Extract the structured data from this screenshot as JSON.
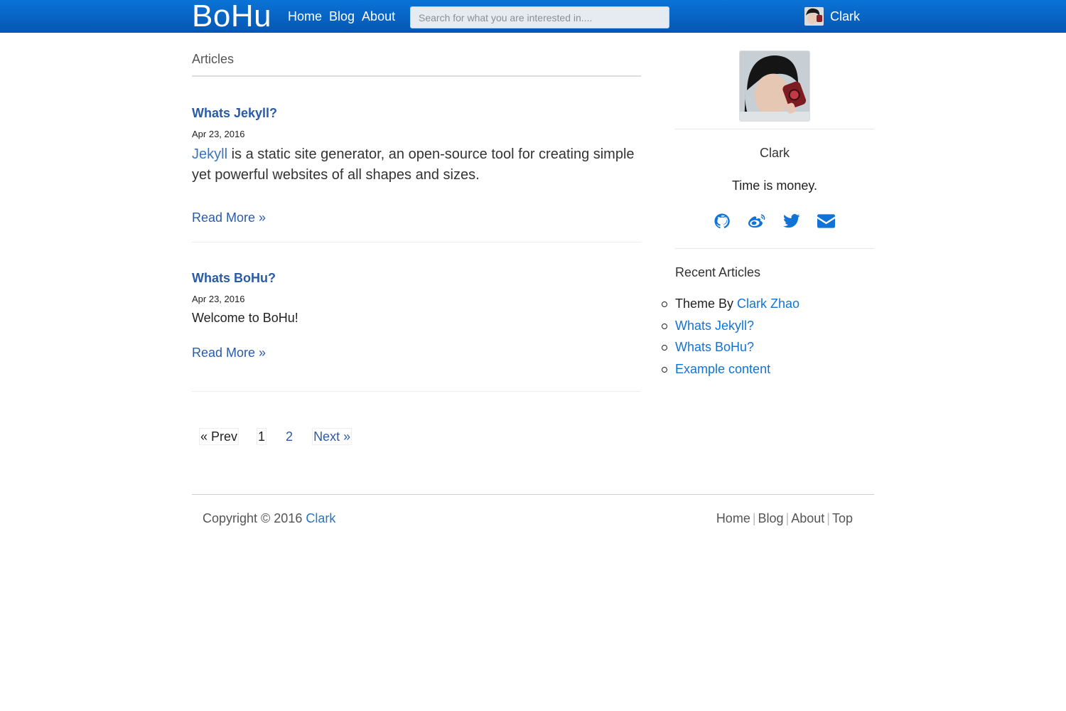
{
  "navbar": {
    "brand": "BoHu",
    "links": [
      "Home",
      "Blog",
      "About"
    ],
    "search_placeholder": "Search for what you are interested in....",
    "user_name": "Clark"
  },
  "main": {
    "section_title": "Articles",
    "posts": [
      {
        "title": "Whats Jekyll?",
        "date": "Apr 23, 2016",
        "excerpt_link": "Jekyll",
        "excerpt_rest": " is a static site generator, an open-source tool for creating simple yet powerful websites of all shapes and sizes.",
        "read_more": "Read More »"
      },
      {
        "title": "Whats BoHu?",
        "date": "Apr 23, 2016",
        "excerpt_link": "",
        "excerpt_rest": "Welcome to BoHu!",
        "read_more": "Read More »"
      }
    ],
    "pagination": {
      "prev": "« Prev",
      "pages": [
        "1",
        "2"
      ],
      "current": "1",
      "next": "Next »"
    }
  },
  "sidebar": {
    "name": "Clark",
    "motto": "Time is money.",
    "socials": [
      "github-icon",
      "weibo-icon",
      "twitter-icon",
      "envelope-icon"
    ],
    "recent_title": "Recent Articles",
    "recent": [
      {
        "prefix": "Theme By ",
        "link": "Clark Zhao"
      },
      {
        "prefix": "",
        "link": "Whats Jekyll?"
      },
      {
        "prefix": "",
        "link": "Whats BoHu?"
      },
      {
        "prefix": "",
        "link": "Example content"
      }
    ]
  },
  "footer": {
    "copyright_prefix": "Copyright © 2016 ",
    "copyright_link": "Clark",
    "links": [
      "Home",
      "Blog",
      "About",
      "Top"
    ]
  },
  "colors": {
    "navbar": "#0a6ad0",
    "link": "#2a5ba6",
    "accent": "#1273d6"
  }
}
